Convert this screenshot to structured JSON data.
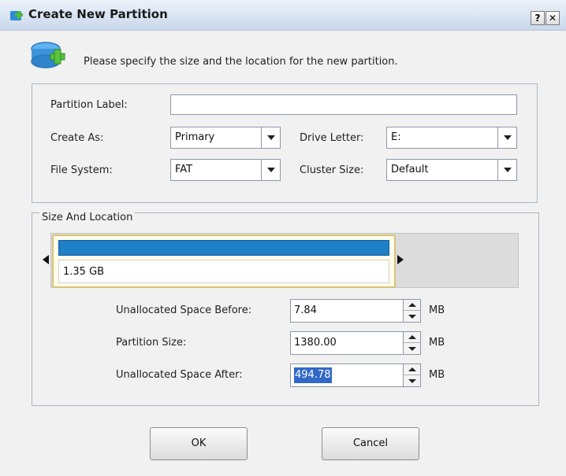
{
  "window": {
    "title": "Create New Partition",
    "help_label": "?",
    "close_label": "✕"
  },
  "header": {
    "instruction": "Please specify the size and the location for the new partition."
  },
  "properties": {
    "partition_label_label": "Partition Label:",
    "partition_label_value": "",
    "create_as_label": "Create As:",
    "create_as_value": "Primary",
    "file_system_label": "File System:",
    "file_system_value": "FAT",
    "drive_letter_label": "Drive Letter:",
    "drive_letter_value": "E:",
    "cluster_size_label": "Cluster Size:",
    "cluster_size_value": "Default"
  },
  "size_location": {
    "group_title": "Size And Location",
    "partition_size_display": "1.35 GB",
    "unallocated_before_label": "Unallocated Space Before:",
    "unallocated_before_value": "7.84",
    "partition_size_label": "Partition Size:",
    "partition_size_value": "1380.00",
    "unallocated_after_label": "Unallocated Space After:",
    "unallocated_after_value": "494.78",
    "unit": "MB"
  },
  "buttons": {
    "ok_label": "OK",
    "cancel_label": "Cancel"
  },
  "colors": {
    "partition_bar": "#1f7fc7",
    "selection": "#3169c6"
  }
}
